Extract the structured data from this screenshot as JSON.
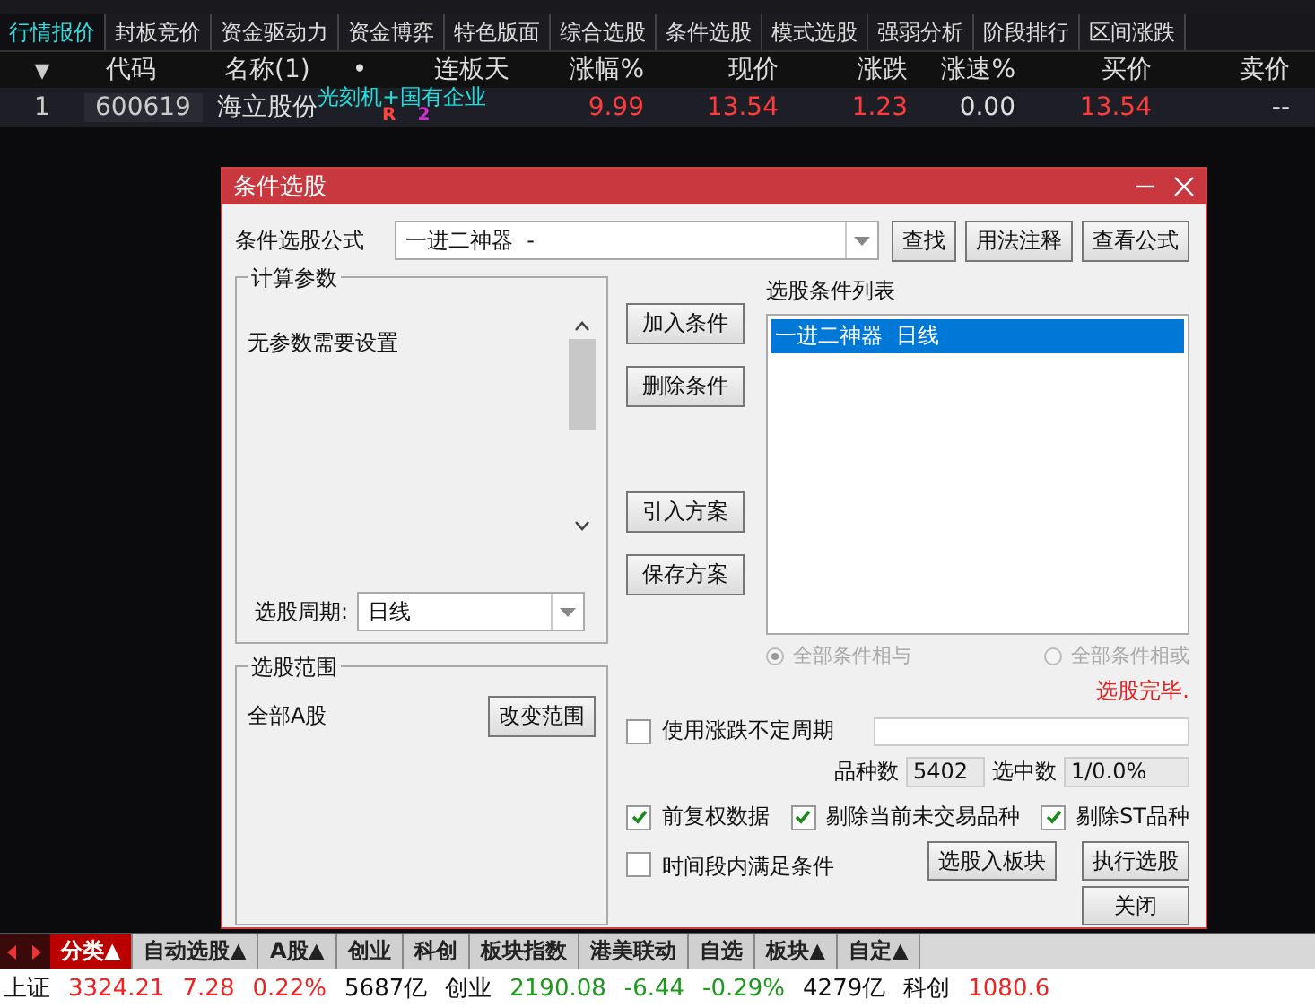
{
  "top_tabs": [
    {
      "label": "行情报价",
      "selected": true
    },
    {
      "label": "封板竞价",
      "selected": false
    },
    {
      "label": "资金驱动力",
      "selected": false
    },
    {
      "label": "资金博弈",
      "selected": false
    },
    {
      "label": "特色版面",
      "selected": false
    },
    {
      "label": "综合选股",
      "selected": false
    },
    {
      "label": "条件选股",
      "selected": false
    },
    {
      "label": "模式选股",
      "selected": false
    },
    {
      "label": "强弱分析",
      "selected": false
    },
    {
      "label": "阶段排行",
      "selected": false
    },
    {
      "label": "区间涨跌",
      "selected": false
    }
  ],
  "table": {
    "columns": [
      "▼",
      "代码",
      "名称(1)",
      "•",
      "连板天",
      "涨幅%",
      "现价",
      "涨跌",
      "涨速%",
      "买价",
      "卖价"
    ],
    "rows": [
      {
        "index": "1",
        "code": "600619",
        "name": "海立股份",
        "tags": "光刻机+国有企业",
        "marks": [
          "R",
          "2"
        ],
        "change_pct": "9.99",
        "price": "13.54",
        "change": "1.23",
        "speed": "0.00",
        "bid": "13.54",
        "ask": "--"
      }
    ]
  },
  "dialog": {
    "title": "条件选股",
    "formula_label": "条件选股公式",
    "formula_value": "一进二神器  -",
    "formula_buttons": [
      "查找",
      "用法注释",
      "查看公式"
    ],
    "params_group": {
      "title": "计算参数",
      "text": "无参数需要设置",
      "period_label": "选股周期:",
      "period_value": "日线"
    },
    "action_buttons": [
      "加入条件",
      "删除条件",
      "引入方案",
      "保存方案"
    ],
    "list_title": "选股条件列表",
    "conditions": [
      {
        "label": "一进二神器  日线",
        "selected": true
      }
    ],
    "radios": [
      {
        "label": "全部条件相与",
        "selected": true,
        "disabled": true
      },
      {
        "label": "全部条件相或",
        "selected": false,
        "disabled": true
      }
    ],
    "status": "选股完毕.",
    "scope_group": {
      "title": "选股范围",
      "value": "全部A股",
      "button": "改变范围"
    },
    "variable_period": {
      "label": "使用涨跌不定周期",
      "checked": false
    },
    "count_label": "品种数",
    "count_value": "5402",
    "selected_label": "选中数",
    "selected_value": "1/0.0%",
    "checkboxes": [
      {
        "label": "前复权数据",
        "checked": true
      },
      {
        "label": "剔除当前未交易品种",
        "checked": true
      },
      {
        "label": "剔除ST品种",
        "checked": true
      }
    ],
    "time_condition": {
      "label": "时间段内满足条件",
      "checked": false
    },
    "bottom_buttons": [
      "选股入板块",
      "执行选股",
      "关闭"
    ]
  },
  "bottom_tabs": [
    {
      "label": "分类▲",
      "selected": true
    },
    {
      "label": "自动选股▲",
      "selected": false
    },
    {
      "label": "A股▲",
      "selected": false
    },
    {
      "label": "创业",
      "selected": false
    },
    {
      "label": "科创",
      "selected": false
    },
    {
      "label": "板块指数",
      "selected": false
    },
    {
      "label": "港美联动",
      "selected": false
    },
    {
      "label": "自选",
      "selected": false
    },
    {
      "label": "板块▲",
      "selected": false
    },
    {
      "label": "自定▲",
      "selected": false
    }
  ],
  "status_bar": [
    {
      "text": "上证",
      "kind": "label"
    },
    {
      "text": "3324.21",
      "kind": "up"
    },
    {
      "text": "7.28",
      "kind": "up"
    },
    {
      "text": "0.22%",
      "kind": "up"
    },
    {
      "text": "5687亿",
      "kind": "plain"
    },
    {
      "text": "创业",
      "kind": "label"
    },
    {
      "text": "2190.08",
      "kind": "down"
    },
    {
      "text": "-6.44",
      "kind": "down"
    },
    {
      "text": "-0.29%",
      "kind": "down"
    },
    {
      "text": "4279亿",
      "kind": "plain"
    },
    {
      "text": "科创",
      "kind": "label"
    },
    {
      "text": "1080.6",
      "kind": "up"
    }
  ]
}
